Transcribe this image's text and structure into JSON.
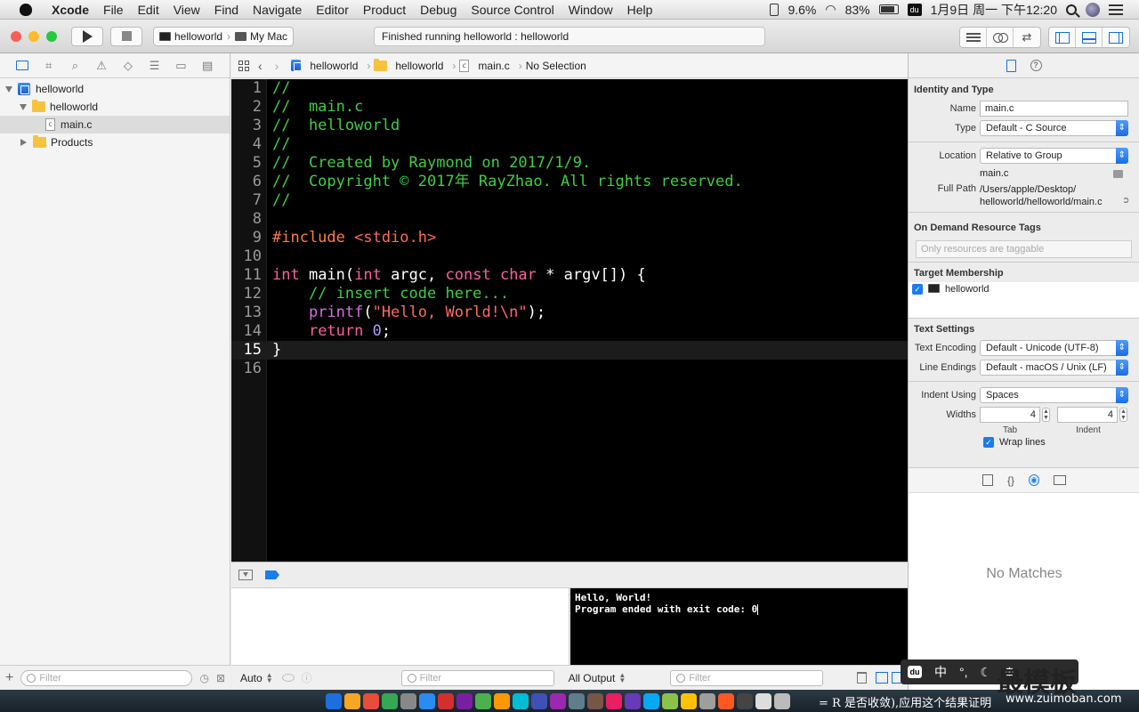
{
  "menubar": {
    "app": "Xcode",
    "items": [
      "File",
      "Edit",
      "View",
      "Find",
      "Navigate",
      "Editor",
      "Product",
      "Debug",
      "Source Control",
      "Window",
      "Help"
    ],
    "status": {
      "cpu": "9.6%",
      "battery": "83%",
      "datetime": "1月9日 周一 下午12:20"
    }
  },
  "toolbar": {
    "scheme": "helloworld",
    "destination": "My Mac",
    "activity": "Finished running helloworld : helloworld"
  },
  "navigator": {
    "tree": [
      {
        "label": "helloworld",
        "kind": "project",
        "level": 0,
        "open": true
      },
      {
        "label": "helloworld",
        "kind": "folder",
        "level": 1,
        "open": true
      },
      {
        "label": "main.c",
        "kind": "cfile",
        "level": 2,
        "selected": true
      },
      {
        "label": "Products",
        "kind": "folder",
        "level": 1,
        "open": false
      }
    ],
    "filter_placeholder": "Filter"
  },
  "jumpbar": {
    "crumbs": [
      "helloworld",
      "helloworld",
      "main.c",
      "No Selection"
    ]
  },
  "editor": {
    "current_line": 15,
    "lines": [
      [
        {
          "t": "//",
          "c": "cm"
        }
      ],
      [
        {
          "t": "//  main.c",
          "c": "cm"
        }
      ],
      [
        {
          "t": "//  helloworld",
          "c": "cm"
        }
      ],
      [
        {
          "t": "//",
          "c": "cm"
        }
      ],
      [
        {
          "t": "//  Created by Raymond on 2017/1/9.",
          "c": "cm"
        }
      ],
      [
        {
          "t": "//  Copyright © 2017年 RayZhao. All rights reserved.",
          "c": "cm"
        }
      ],
      [
        {
          "t": "//",
          "c": "cm"
        }
      ],
      [],
      [
        {
          "t": "#include ",
          "c": "pp"
        },
        {
          "t": "<stdio.h>",
          "c": "str"
        }
      ],
      [],
      [
        {
          "t": "int",
          "c": "kw"
        },
        {
          "t": " main(",
          "c": "pl"
        },
        {
          "t": "int",
          "c": "kw"
        },
        {
          "t": " argc, ",
          "c": "pl"
        },
        {
          "t": "const",
          "c": "kw"
        },
        {
          "t": " ",
          "c": "pl"
        },
        {
          "t": "char",
          "c": "kw"
        },
        {
          "t": " * argv[]) {",
          "c": "pl"
        }
      ],
      [
        {
          "t": "    // insert code here...",
          "c": "cm"
        }
      ],
      [
        {
          "t": "    ",
          "c": "pl"
        },
        {
          "t": "printf",
          "c": "fn"
        },
        {
          "t": "(",
          "c": "pl"
        },
        {
          "t": "\"Hello, World!\\n\"",
          "c": "str"
        },
        {
          "t": ");",
          "c": "pl"
        }
      ],
      [
        {
          "t": "    ",
          "c": "pl"
        },
        {
          "t": "return",
          "c": "kw"
        },
        {
          "t": " ",
          "c": "pl"
        },
        {
          "t": "0",
          "c": "num"
        },
        {
          "t": ";",
          "c": "pl"
        }
      ],
      [
        {
          "t": "}",
          "c": "pl"
        }
      ],
      []
    ]
  },
  "debug": {
    "console_lines": [
      "Hello, World!",
      "Program ended with exit code: 0"
    ],
    "auto_label": "Auto",
    "output_label": "All Output",
    "filter_placeholder": "Filter"
  },
  "inspector": {
    "identity_title": "Identity and Type",
    "name_label": "Name",
    "name_value": "main.c",
    "type_label": "Type",
    "type_value": "Default - C Source",
    "location_label": "Location",
    "location_value": "Relative to Group",
    "location_file": "main.c",
    "fullpath_label": "Full Path",
    "fullpath_value_1": "/Users/apple/Desktop/",
    "fullpath_value_2": "helloworld/helloworld/main.c",
    "tags_title": "On Demand Resource Tags",
    "tags_hint": "Only resources are taggable",
    "target_title": "Target Membership",
    "target_name": "helloworld",
    "text_title": "Text Settings",
    "encoding_label": "Text Encoding",
    "encoding_value": "Default - Unicode (UTF-8)",
    "endings_label": "Line Endings",
    "endings_value": "Default - macOS / Unix (LF)",
    "indent_label": "Indent Using",
    "indent_value": "Spaces",
    "widths_label": "Widths",
    "tab_width": "4",
    "indent_width": "4",
    "tab_caption": "Tab",
    "indent_caption": "Indent",
    "wrap_label": "Wrap lines",
    "library_empty": "No Matches"
  },
  "overlay": {
    "ime": [
      "中",
      "°,",
      "☾",
      "⚙"
    ],
    "brand": "最模板",
    "brand_url": "www.zuimoban.com",
    "dock_text": "= R 是否收敛),应用这个结果证明"
  }
}
